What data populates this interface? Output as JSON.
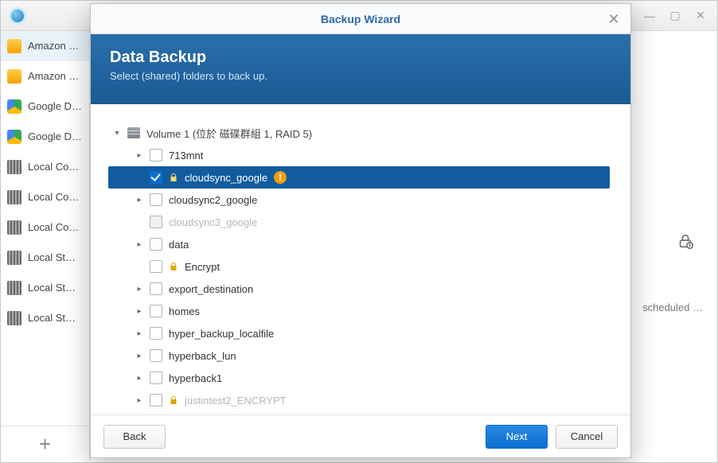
{
  "window": {
    "controls": {
      "min": "—",
      "max": "▢",
      "close": "✕"
    }
  },
  "sidebar": {
    "items": [
      {
        "label": "Amazon D…",
        "icon": "amazon",
        "selected": true
      },
      {
        "label": "Amazon D…",
        "icon": "amazon"
      },
      {
        "label": "Google D…",
        "icon": "google"
      },
      {
        "label": "Google D test",
        "icon": "google"
      },
      {
        "label": "Local Co…",
        "icon": "local"
      },
      {
        "label": "Local Co…",
        "icon": "local"
      },
      {
        "label": "Local Co…",
        "icon": "local"
      },
      {
        "label": "Local St…",
        "icon": "local"
      },
      {
        "label": "Local St…",
        "icon": "local"
      },
      {
        "label": "Local St…",
        "icon": "local"
      }
    ],
    "add_glyph": "+"
  },
  "detail": {
    "scheduled_text": "scheduled …"
  },
  "modal": {
    "title": "Backup Wizard",
    "close_glyph": "✕",
    "heading": "Data Backup",
    "subheading": "Select (shared) folders to back up.",
    "volume_label": "Volume 1 (位於 磁碟群組 1, RAID 5)",
    "folders": [
      {
        "label": "713mnt",
        "expandable": true
      },
      {
        "label": "cloudsync_google",
        "expandable": false,
        "checked": true,
        "lock": true,
        "warn": true,
        "selected": true
      },
      {
        "label": "cloudsync2_google",
        "expandable": true
      },
      {
        "label": "cloudsync3_google",
        "expandable": false,
        "disabled": true
      },
      {
        "label": "data",
        "expandable": true
      },
      {
        "label": "Encrypt",
        "expandable": false,
        "lock": true
      },
      {
        "label": "export_destination",
        "expandable": true
      },
      {
        "label": "homes",
        "expandable": true
      },
      {
        "label": "hyper_backup_localfile",
        "expandable": true
      },
      {
        "label": "hyperback_lun",
        "expandable": true
      },
      {
        "label": "hyperback1",
        "expandable": true
      },
      {
        "label": "justintest2_ENCRYPT",
        "expandable": true,
        "lock": true,
        "faded": true
      }
    ],
    "buttons": {
      "back": "Back",
      "next": "Next",
      "cancel": "Cancel"
    }
  }
}
